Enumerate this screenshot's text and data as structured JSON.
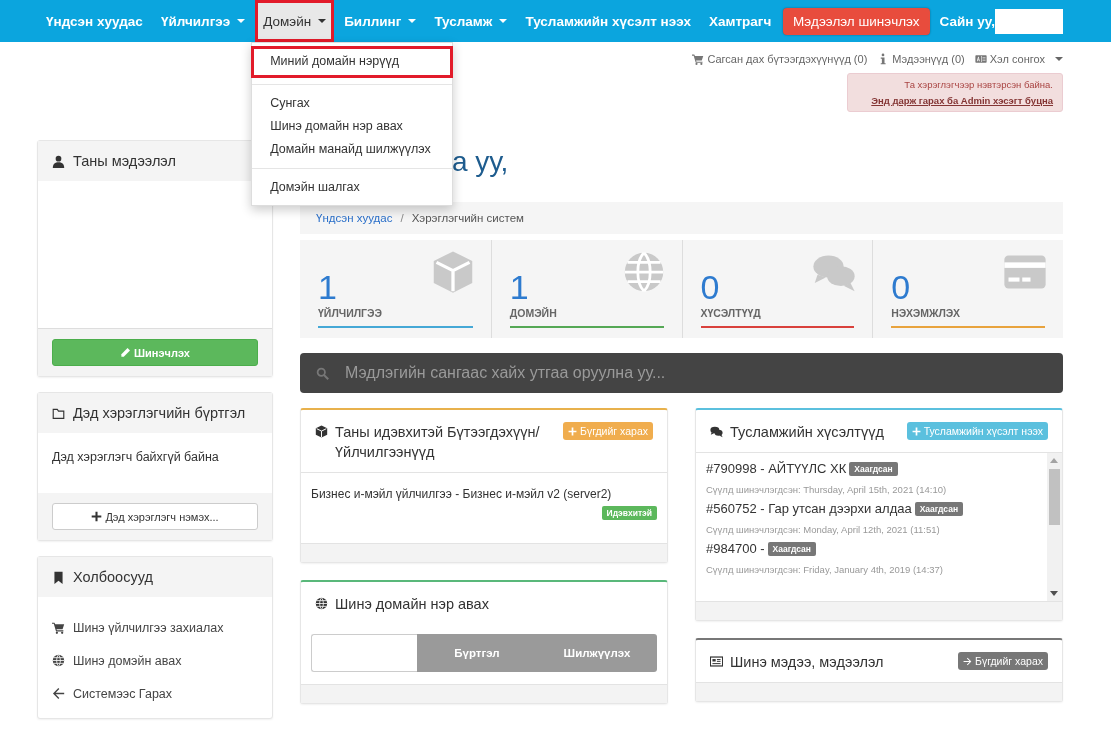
{
  "navbar": {
    "items": [
      {
        "label": "Үндсэн хуудас",
        "caret": false,
        "open": false,
        "highlighted": false
      },
      {
        "label": "Үйлчилгээ",
        "caret": true,
        "open": false,
        "highlighted": false
      },
      {
        "label": "Домэйн",
        "caret": true,
        "open": true,
        "highlighted": true
      },
      {
        "label": "Биллинг",
        "caret": true,
        "open": false,
        "highlighted": false
      },
      {
        "label": "Тусламж",
        "caret": true,
        "open": false,
        "highlighted": false
      },
      {
        "label": "Тусламжийн хүсэлт нээх",
        "caret": false,
        "open": false,
        "highlighted": false
      },
      {
        "label": "Хамтрагч",
        "caret": false,
        "open": false,
        "highlighted": false
      }
    ],
    "update_button": "Мэдээлэл шинэчлэх",
    "greeting": "Сайн уу,"
  },
  "dropdown": {
    "groups": [
      [
        {
          "label": "Миний домайн нэрүүд",
          "highlighted": true
        }
      ],
      [
        {
          "label": "Сунгах",
          "highlighted": false
        },
        {
          "label": "Шинэ домайн нэр авах",
          "highlighted": false
        },
        {
          "label": "Домайн манайд шилжүүлэх",
          "highlighted": false
        }
      ],
      [
        {
          "label": "Домэйн шалгах",
          "highlighted": false
        }
      ]
    ]
  },
  "top_links": [
    {
      "kind": "cart",
      "label": "Сагсан дах бүтээгдэхүүнүүд (0)",
      "caret": false
    },
    {
      "kind": "info",
      "label": "Мэдээнүүд (0)",
      "caret": false
    },
    {
      "kind": "language",
      "label": "Хэл сонгох",
      "caret": true
    }
  ],
  "alert": {
    "text": "Та хэрэглэгчээр нэвтэрсэн байна.",
    "link": "Энд дарж гарах ба Admin хэсэгт буцна"
  },
  "heading": "а уу,",
  "breadcrumb_separator": "/",
  "breadcrumb": [
    {
      "label": "Үндсэн хуудас",
      "link": true
    },
    {
      "label": "Хэрэглэгчийн систем",
      "link": false
    }
  ],
  "sidebar": {
    "panels": [
      {
        "kind": "info",
        "title": "Таны мэдээлэл",
        "button": "Шинэчлэх"
      },
      {
        "kind": "subusers",
        "title": "Дэд хэрэглэгчийн бүртгэл",
        "text": "Дэд хэрэглэгч байхгүй байна",
        "button": "Дэд хэрэглэгч нэмэх..."
      },
      {
        "kind": "links",
        "title": "Холбоосууд",
        "links": [
          {
            "kind": "cart",
            "label": "Шинэ үйлчилгээ захиалах"
          },
          {
            "kind": "globe",
            "label": "Шинэ домэйн авах"
          },
          {
            "kind": "arrow-left",
            "label": "Системээс Гарах"
          }
        ]
      }
    ]
  },
  "stats": [
    {
      "kind": "cube",
      "value": "1",
      "label": "ҮЙЛЧИЛГЭЭ",
      "color": "#45a8d6"
    },
    {
      "kind": "globe",
      "value": "1",
      "label": "ДОМЭЙН",
      "color": "#55a855"
    },
    {
      "kind": "comments",
      "value": "0",
      "label": "ХҮСЭЛТҮҮД",
      "color": "#d9413c"
    },
    {
      "kind": "card",
      "value": "0",
      "label": "НЭХЭМЖЛЭХ",
      "color": "#e8a33d"
    }
  ],
  "kb_search": {
    "placeholder": "Мэдлэгийн сангаас хайх утгаа оруулна уу..."
  },
  "products": {
    "title": "Таны идэвхитэй Бүтээгдэхүүн/ Үйлчилгээнүүд",
    "button": "Бүгдийг харах",
    "items": [
      {
        "name": "Бизнес и-мэйл үйлчилгээ - Бизнес и-мэйл v2 (server2)",
        "status": "Идэвхитэй"
      }
    ]
  },
  "domain_panel": {
    "title": "Шинэ домайн нэр авах",
    "buttons": [
      "Бүртгэл",
      "Шилжүүлэх"
    ]
  },
  "tickets": {
    "title": "Тусламжийн хүсэлтүүд",
    "button": "Тусламжийн хүсэлт нээх",
    "items": [
      {
        "title": "#790998 - АЙТҮҮЛС ХК",
        "status": "Хаагдсан",
        "updated": "Сүүлд шинэчлэгдсэн: Thursday, April 15th, 2021 (14:10)"
      },
      {
        "title": "#560752 - Гар утсан дээрхи алдаа",
        "status": "Хаагдсан",
        "updated": "Сүүлд шинэчлэгдсэн: Monday, April 12th, 2021 (11:51)"
      },
      {
        "title": "#984700 -",
        "status": "Хаагдсан",
        "updated": "Сүүлд шинэчлэгдсэн: Friday, January 4th, 2019 (14:37)"
      }
    ]
  },
  "news": {
    "title": "Шинэ мэдээ, мэдээлэл",
    "button": "Бүгдийг харах"
  }
}
